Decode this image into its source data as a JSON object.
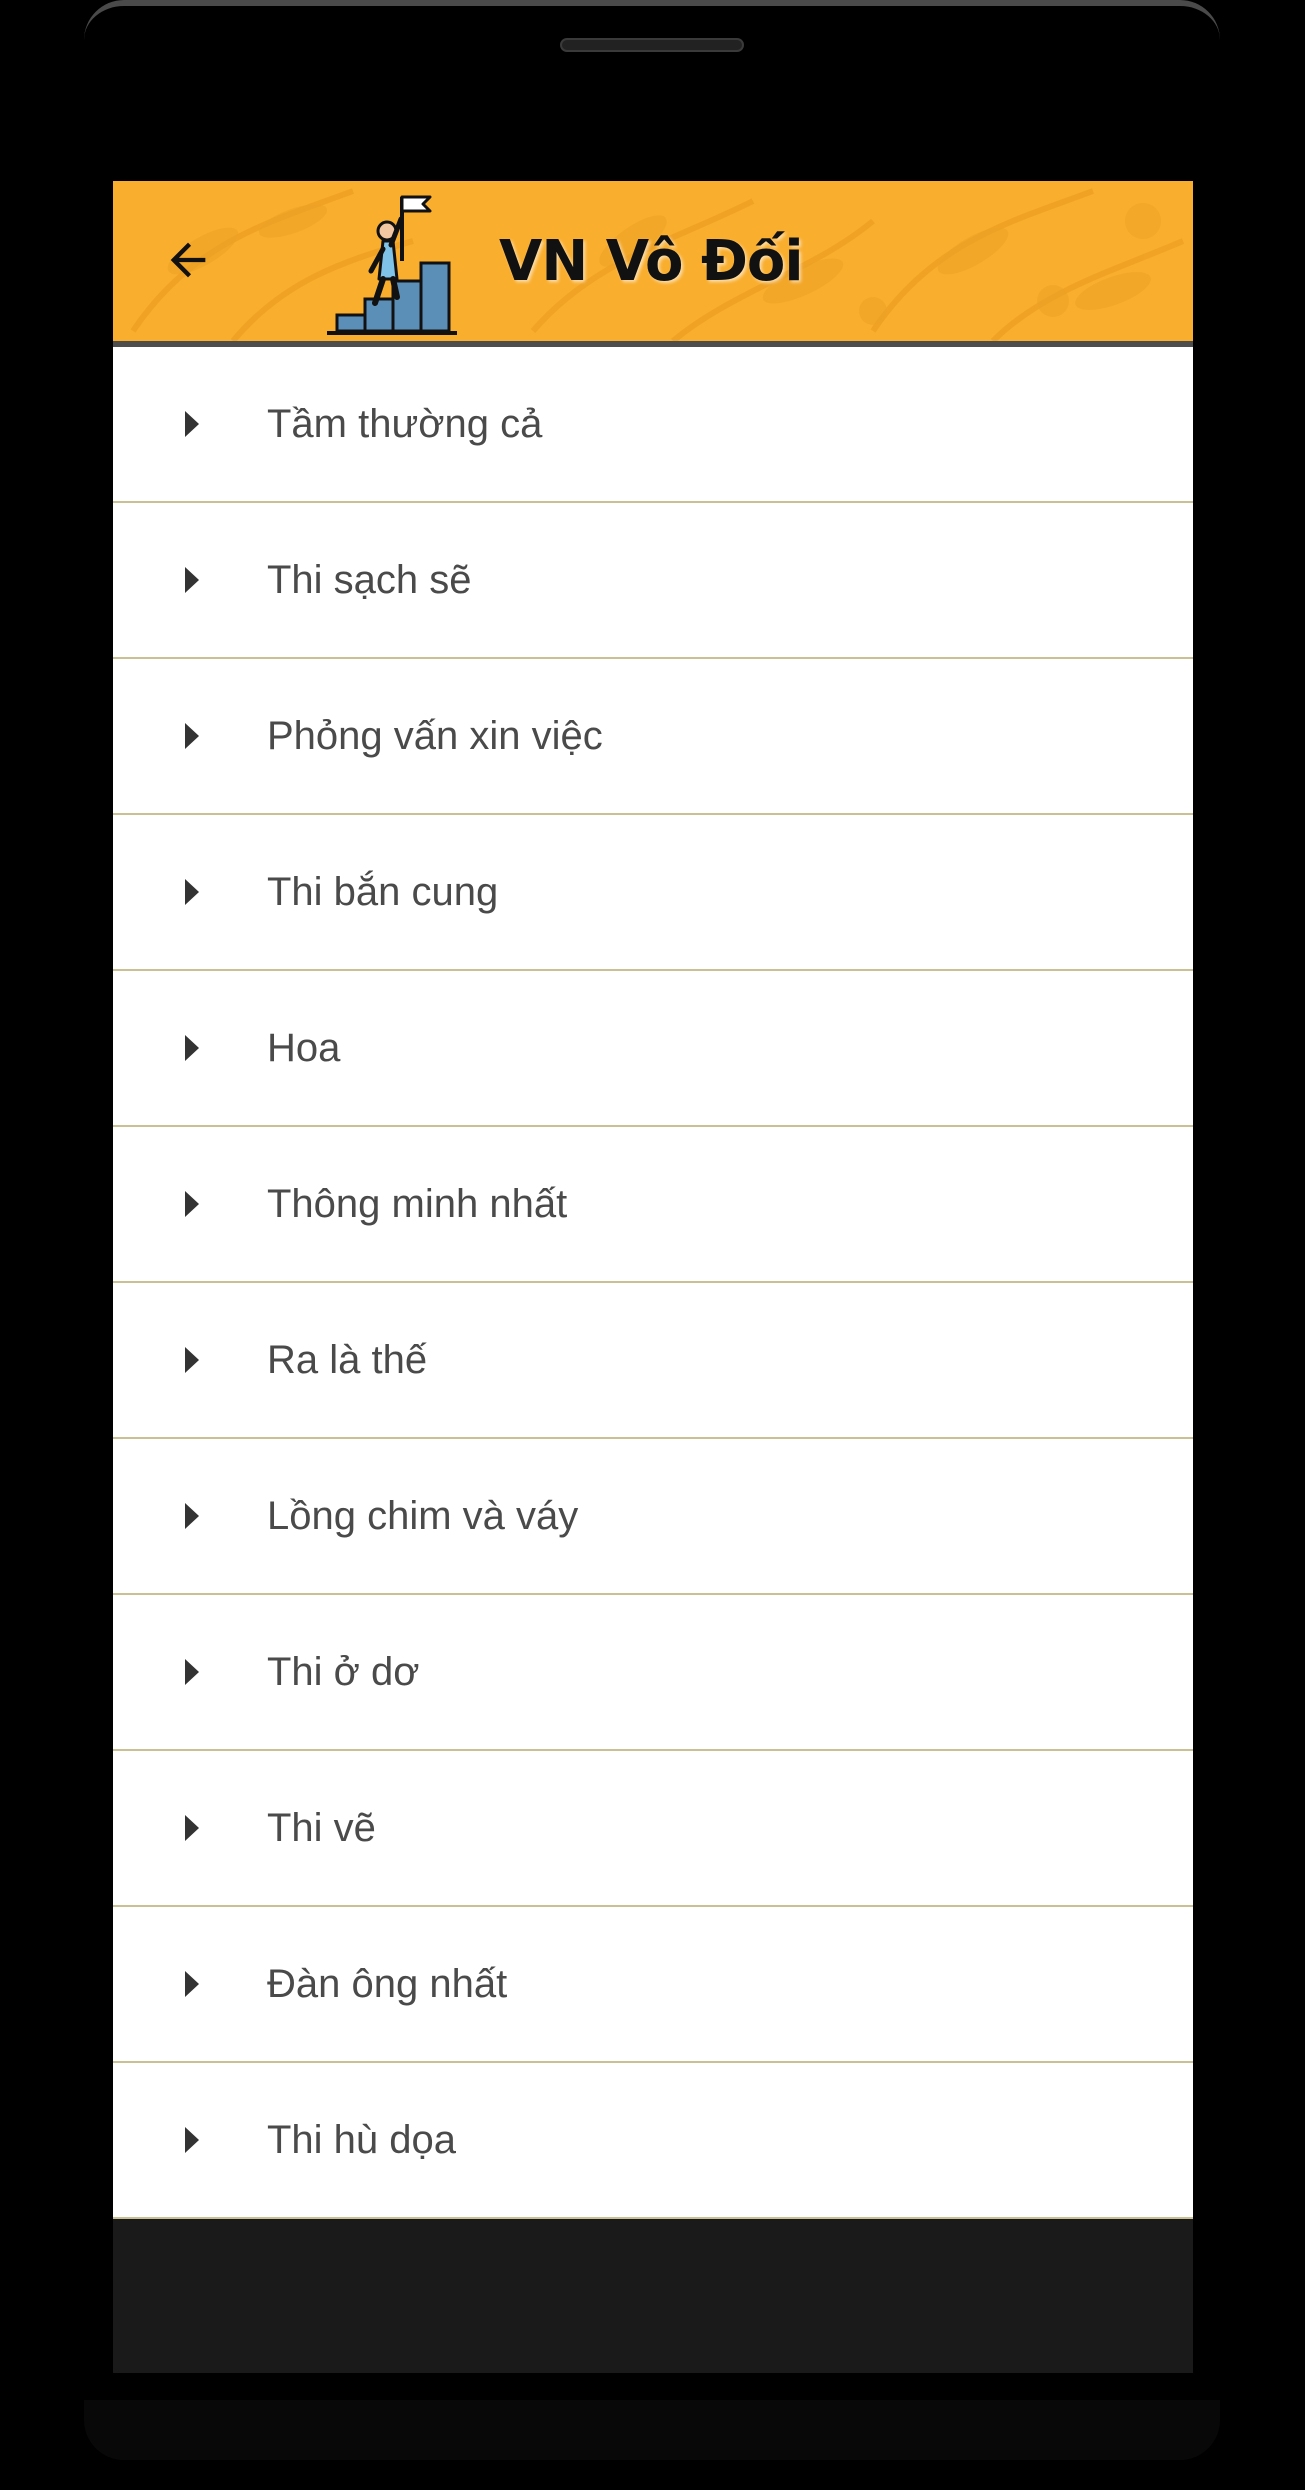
{
  "app": {
    "title": "VN Vô Đối",
    "back_icon": "arrow-left-icon",
    "logo_icon": "person-climbing-stairs-flag-icon"
  },
  "colors": {
    "appbar": "#f9ae2e",
    "divider": "#c9c193",
    "text": "#4a4a4a"
  },
  "list": {
    "items": [
      {
        "label": "Tầm thường cả",
        "icon": "caret-right-icon"
      },
      {
        "label": "Thi sạch sẽ",
        "icon": "caret-right-icon"
      },
      {
        "label": "Phỏng vấn xin việc",
        "icon": "caret-right-icon"
      },
      {
        "label": "Thi bắn cung",
        "icon": "caret-right-icon"
      },
      {
        "label": "Hoa",
        "icon": "caret-right-icon"
      },
      {
        "label": "Thông minh nhất",
        "icon": "caret-right-icon"
      },
      {
        "label": "Ra là thế",
        "icon": "caret-right-icon"
      },
      {
        "label": "Lồng chim và váy",
        "icon": "caret-right-icon"
      },
      {
        "label": "Thi ở dơ",
        "icon": "caret-right-icon"
      },
      {
        "label": "Thi vẽ",
        "icon": "caret-right-icon"
      },
      {
        "label": "Đàn ông nhất",
        "icon": "caret-right-icon"
      },
      {
        "label": "Thi hù dọa",
        "icon": "caret-right-icon"
      }
    ]
  }
}
